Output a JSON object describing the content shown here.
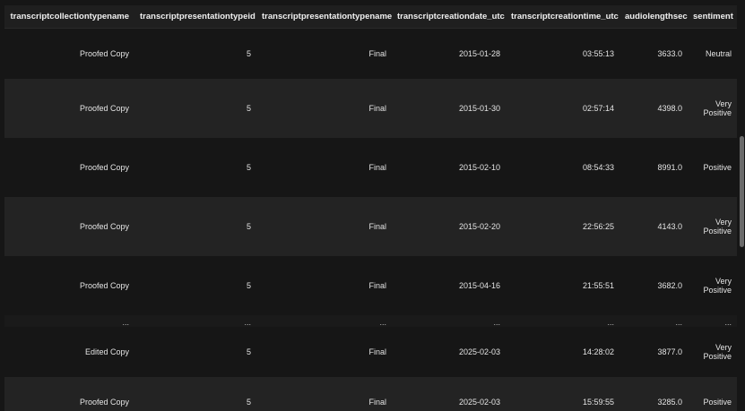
{
  "table": {
    "columns": [
      "transcriptcollectiontypename",
      "transcriptpresentationtypeid",
      "transcriptpresentationtypename",
      "transcriptcreationdate_utc",
      "transcriptcreationtime_utc",
      "audiolengthsec",
      "sentiment"
    ],
    "rows": [
      [
        "Proofed Copy",
        "5",
        "Final",
        "2015-01-28",
        "03:55:13",
        "3633.0",
        "Neutral"
      ],
      [
        "Proofed Copy",
        "5",
        "Final",
        "2015-01-30",
        "02:57:14",
        "4398.0",
        "Very Positive"
      ],
      [
        "Proofed Copy",
        "5",
        "Final",
        "2015-02-10",
        "08:54:33",
        "8991.0",
        "Positive"
      ],
      [
        "Proofed Copy",
        "5",
        "Final",
        "2015-02-20",
        "22:56:25",
        "4143.0",
        "Very Positive"
      ],
      [
        "Proofed Copy",
        "5",
        "Final",
        "2015-04-16",
        "21:55:51",
        "3682.0",
        "Very Positive"
      ]
    ],
    "ellipsis": [
      "...",
      "...",
      "...",
      "...",
      "...",
      "...",
      "..."
    ],
    "tail_rows": [
      [
        "Edited Copy",
        "5",
        "Final",
        "2025-02-03",
        "14:28:02",
        "3877.0",
        "Very Positive"
      ],
      [
        "Proofed Copy",
        "5",
        "Final",
        "2025-02-03",
        "15:59:55",
        "3285.0",
        "Positive"
      ]
    ]
  },
  "colors": {
    "background": "#161616",
    "row_alt": "#232323",
    "header": "#1f1f1f",
    "text": "#e4e4e4",
    "scrollbar_thumb": "#6b6b6b"
  }
}
